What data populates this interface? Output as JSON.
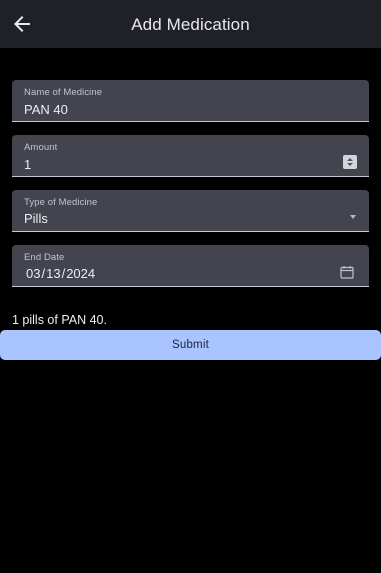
{
  "header": {
    "title": "Add Medication",
    "back_icon": "arrow-left-icon"
  },
  "form": {
    "name": {
      "label": "Name of Medicine",
      "value": "PAN 40"
    },
    "amount": {
      "label": "Amount",
      "value": "1"
    },
    "type": {
      "label": "Type of Medicine",
      "value": "Pills"
    },
    "end_date": {
      "label": "End Date",
      "month": "03",
      "day": "13",
      "year": "2024",
      "separator": "/"
    }
  },
  "summary": "1 pills of PAN 40.",
  "submit_label": "Submit",
  "colors": {
    "background": "#000000",
    "header": "#202127",
    "field": "#43444e",
    "button": "#aac4ff",
    "button_text": "#14233f"
  }
}
